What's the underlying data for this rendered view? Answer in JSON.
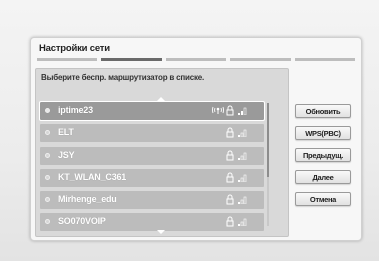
{
  "dialog": {
    "title": "Настройки сети",
    "subtitle": "Выберите беспр. маршрутизатор в списке."
  },
  "steps": {
    "count": 5,
    "active": 2
  },
  "networks": [
    {
      "ssid": "iptime23",
      "selected": true,
      "wps": true,
      "secured": true
    },
    {
      "ssid": "ELT",
      "selected": false,
      "wps": false,
      "secured": true
    },
    {
      "ssid": "JSY",
      "selected": false,
      "wps": false,
      "secured": true
    },
    {
      "ssid": "KT_WLAN_C361",
      "selected": false,
      "wps": false,
      "secured": true
    },
    {
      "ssid": "Mirhenge_edu",
      "selected": false,
      "wps": false,
      "secured": true
    },
    {
      "ssid": "SO070VOIP",
      "selected": false,
      "wps": false,
      "secured": true
    }
  ],
  "buttons": {
    "refresh": "Обновить",
    "wps": "WPS(PBC)",
    "previous": "Предыдущ.",
    "next": "Далее",
    "cancel": "Отмена"
  },
  "icons": {
    "wps": "wps-icon",
    "lock": "lock-icon",
    "signal": "signal-strength-icon"
  },
  "colors": {
    "selected_row": "#9a9a9a",
    "row": "#bcbcbc",
    "panel": "#d9d9d9"
  }
}
